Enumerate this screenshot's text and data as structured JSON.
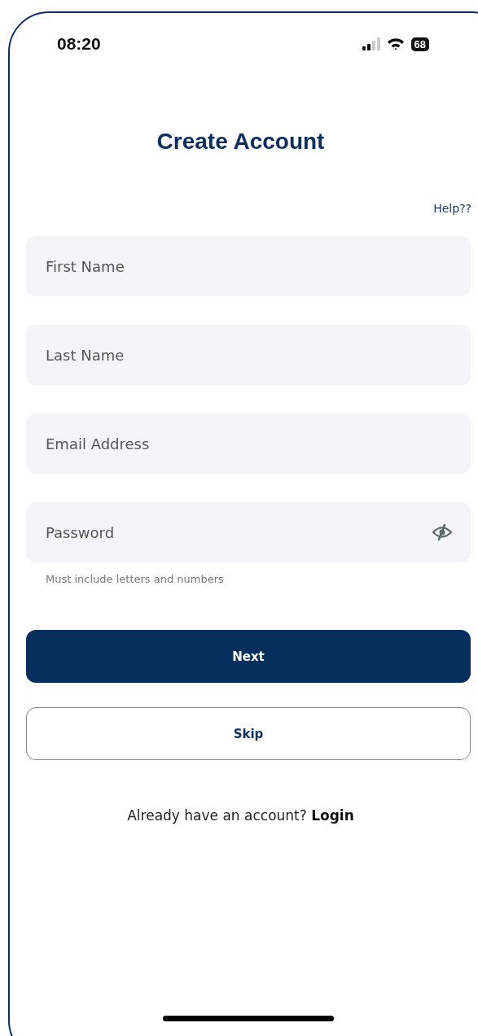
{
  "status_bar": {
    "time": "08:20",
    "battery": "68"
  },
  "title": "Create Account",
  "help_link": "Help??",
  "fields": [
    {
      "placeholder": "First Name",
      "kind": "text"
    },
    {
      "placeholder": "Last Name",
      "kind": "text"
    },
    {
      "placeholder": "Email Address",
      "kind": "email"
    },
    {
      "placeholder": "Password",
      "kind": "password"
    }
  ],
  "password_hint": "Must include letters and numbers",
  "buttons": [
    {
      "label": "Next",
      "kind": "primary"
    },
    {
      "label": "Skip",
      "kind": "secondary"
    }
  ],
  "login_prompt": {
    "text": "Already have an account?",
    "link": "Login"
  }
}
